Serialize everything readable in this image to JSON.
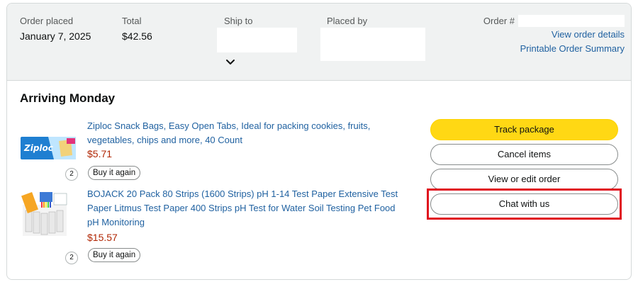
{
  "header": {
    "order_placed_label": "Order placed",
    "order_placed_value": "January 7, 2025",
    "total_label": "Total",
    "total_value": "$42.56",
    "ship_to_label": "Ship to",
    "placed_by_label": "Placed by",
    "order_number_label": "Order #",
    "view_details_link": "View order details",
    "printable_summary_link": "Printable Order Summary"
  },
  "shipment": {
    "title": "Arriving Monday"
  },
  "items": [
    {
      "name": "Ziploc Snack Bags, Easy Open Tabs, Ideal for packing cookies, fruits, vegetables, chips and more, 40 Count",
      "line1": "Ziploc Snack Bags, Easy Open Tabs, Ideal for packing cookies, fruits,",
      "line2": "vegetables, chips and more, 40 Count",
      "price": "$5.71",
      "quantity": "2",
      "buy_again_label": "Buy it again",
      "brand_text": "Ziploc"
    },
    {
      "name": "BOJACK 20 Pack 80 Strips (1600 Strips) pH 1-14 Test Paper Extensive Test Paper Litmus Test Paper 400 Strips pH Test for Water Soil Testing Pet Food pH Monitoring",
      "line1": "BOJACK 20 Pack 80 Strips (1600 Strips) pH 1-14 Test Paper Extensive Test",
      "line2": "Paper Litmus Test Paper 400 Strips pH Test for Water Soil Testing Pet Food",
      "line3": "pH Monitoring",
      "price": "$15.57",
      "quantity": "2",
      "buy_again_label": "Buy it again"
    }
  ],
  "actions": {
    "track_package": "Track package",
    "cancel_items": "Cancel items",
    "view_edit_order": "View or edit order",
    "chat_with_us": "Chat with us"
  },
  "colors": {
    "accent_yellow": "#ffd814",
    "link_blue": "#2162a1",
    "price_red": "#b12704",
    "highlight_red": "#e0101d",
    "header_bg": "#f0f2f2"
  },
  "icons": {
    "expand": "chevron-down-icon"
  }
}
